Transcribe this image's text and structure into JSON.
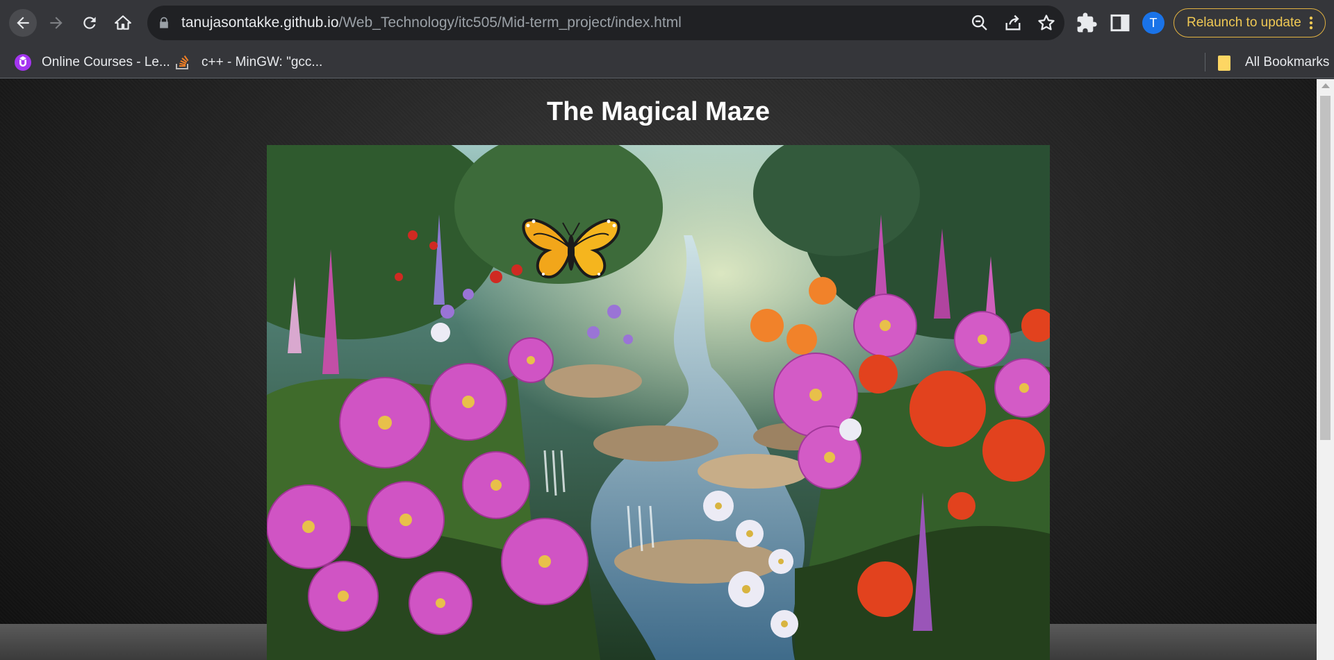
{
  "browser": {
    "url_host": "tanujasontakke.github.io",
    "url_path": "/Web_Technology/itc505/Mid-term_project/index.html",
    "relaunch_label": "Relaunch to update",
    "avatar_initial": "T",
    "bookmarks": [
      {
        "label": "Online Courses - Le...",
        "icon": "udemy-icon"
      },
      {
        "label": "c++ - MinGW: \"gcc...",
        "icon": "stackoverflow-icon"
      }
    ],
    "all_bookmarks_label": "All Bookmarks"
  },
  "page": {
    "title": "The Magical Maze",
    "image": {
      "icon": "garden-illustration",
      "subject": "garden-with-stream-and-butterfly"
    }
  },
  "colors": {
    "toolbar": "#35363a",
    "omnibox": "#202124",
    "relaunch_accent": "#e3b341",
    "avatar": "#1a73e8"
  }
}
